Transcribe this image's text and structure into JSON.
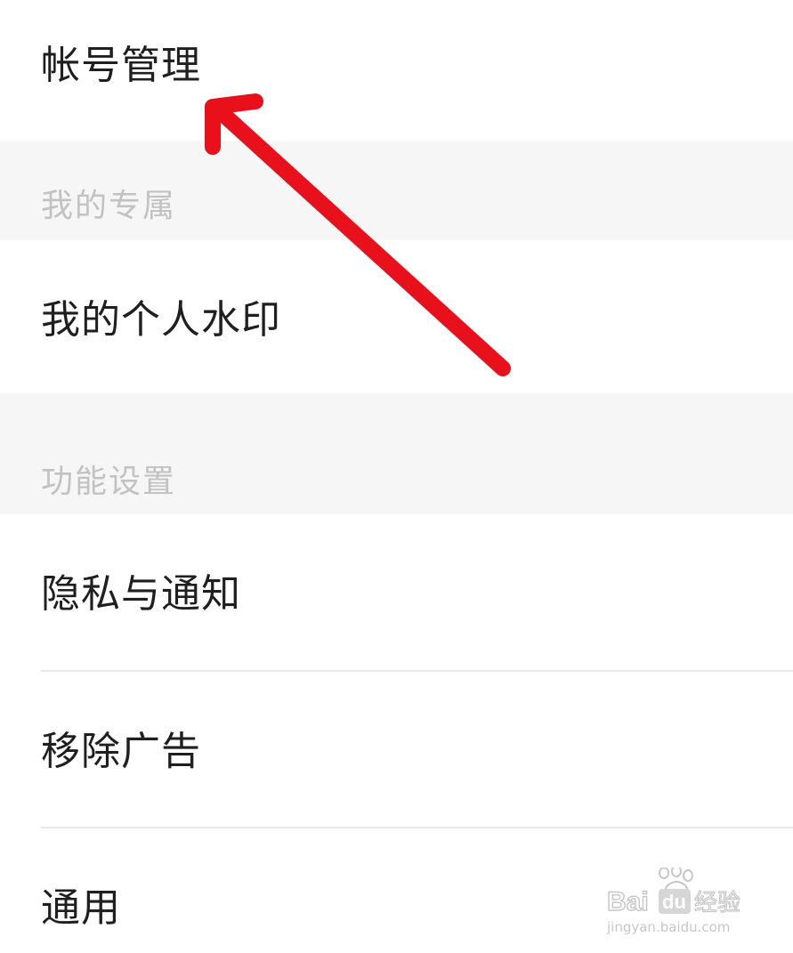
{
  "settings": {
    "account": {
      "label": "帐号管理"
    },
    "section_mine": {
      "label": "我的专属"
    },
    "watermark_item": {
      "label": "我的个人水印"
    },
    "section_features": {
      "label": "功能设置"
    },
    "privacy": {
      "label": "隐私与通知"
    },
    "remove_ads": {
      "label": "移除广告"
    },
    "general": {
      "label": "通用"
    }
  },
  "annotation": {
    "arrow_color": "#e8111b",
    "arrow_target": "account"
  },
  "watermark": {
    "brand": "Bai",
    "brand_mid": "du",
    "brand_cn": "经验",
    "url": "jingyan.baidu.com"
  },
  "colors": {
    "section_bg": "#f6f6f6",
    "section_text": "#c2c2c2",
    "item_text": "#1f1f1f",
    "divider": "#e8e8e8"
  }
}
